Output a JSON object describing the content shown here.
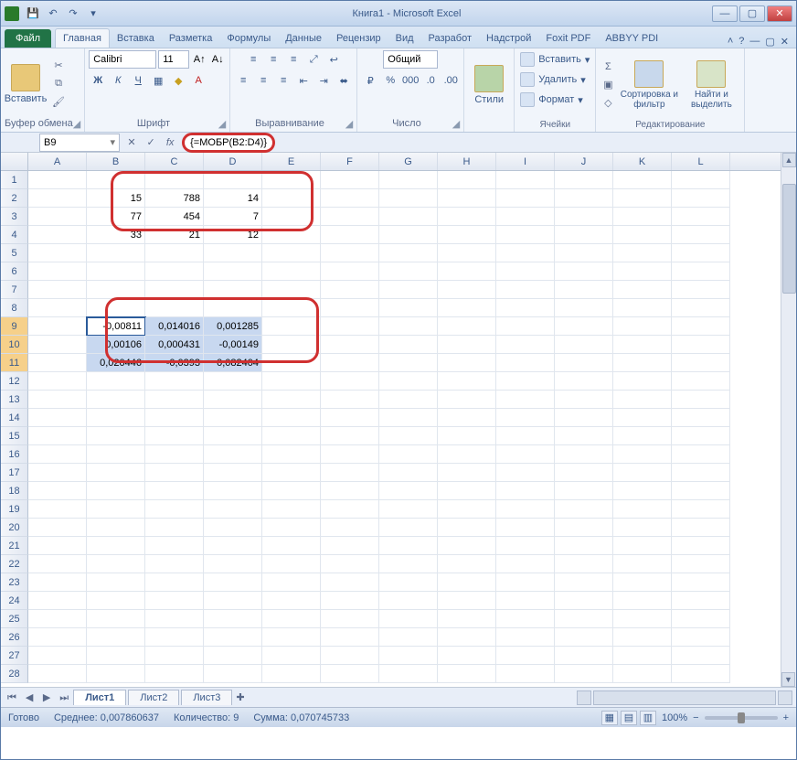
{
  "titlebar": {
    "title": "Книга1 - Microsoft Excel"
  },
  "tabs": {
    "file": "Файл",
    "items": [
      "Главная",
      "Вставка",
      "Разметка",
      "Формулы",
      "Данные",
      "Рецензир",
      "Вид",
      "Разработ",
      "Надстрой",
      "Foxit PDF",
      "ABBYY PDI"
    ],
    "active": 0
  },
  "ribbon": {
    "clipboard": {
      "paste": "Вставить",
      "label": "Буфер обмена"
    },
    "font": {
      "name": "Calibri",
      "size": "11",
      "label": "Шрифт"
    },
    "align": {
      "label": "Выравнивание"
    },
    "number": {
      "format": "Общий",
      "label": "Число"
    },
    "styles": {
      "btn": "Стили",
      "label": ""
    },
    "cells": {
      "insert": "Вставить",
      "delete": "Удалить",
      "format": "Формат",
      "label": "Ячейки"
    },
    "editing": {
      "sort": "Сортировка и фильтр",
      "find": "Найти и выделить",
      "label": "Редактирование"
    }
  },
  "namebox": "B9",
  "formula": "{=МОБР(B2:D4)}",
  "columns": [
    "A",
    "B",
    "C",
    "D",
    "E",
    "F",
    "G",
    "H",
    "I",
    "J",
    "K",
    "L"
  ],
  "cells": {
    "r2": {
      "B": "15",
      "C": "788",
      "D": "14"
    },
    "r3": {
      "B": "77",
      "C": "454",
      "D": "7"
    },
    "r4": {
      "B": "33",
      "C": "21",
      "D": "12"
    },
    "r9": {
      "B": "-0,00811",
      "C": "0,014016",
      "D": "0,001285"
    },
    "r10": {
      "B": "0,00106",
      "C": "0,000431",
      "D": "-0,00149"
    },
    "r11": {
      "B": "0,020446",
      "C": "-0,0393",
      "D": "0,082404"
    }
  },
  "sheets": {
    "items": [
      "Лист1",
      "Лист2",
      "Лист3"
    ],
    "active": 0
  },
  "status": {
    "ready": "Готово",
    "avg_label": "Среднее:",
    "avg": "0,007860637",
    "count_label": "Количество:",
    "count": "9",
    "sum_label": "Сумма:",
    "sum": "0,070745733",
    "zoom": "100%"
  }
}
